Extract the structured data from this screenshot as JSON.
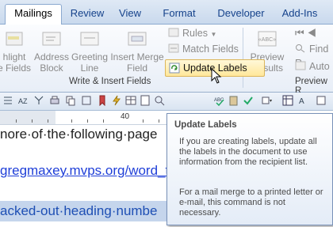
{
  "tabs": [
    {
      "label": "Mailings",
      "active": true
    },
    {
      "label": "Review"
    },
    {
      "label": "View"
    },
    {
      "label": "Format"
    },
    {
      "label": "Developer"
    },
    {
      "label": "Add-Ins"
    }
  ],
  "ribbon": {
    "highlight_merge_fields": {
      "line1": "hlight",
      "line2": "e Fields"
    },
    "address_block": {
      "line1": "Address",
      "line2": "Block"
    },
    "greeting_line": {
      "line1": "Greeting",
      "line2": "Line"
    },
    "insert_merge_field": {
      "line1": "Insert Merge",
      "line2": "Field"
    },
    "rules": "Rules",
    "match_fields": "Match Fields",
    "update_labels": "Update Labels",
    "group_write_insert": "Write & Insert Fields",
    "preview_results": {
      "line1": "Preview",
      "line2": "Results"
    },
    "find_re": "Find R",
    "auto": "Auto",
    "group_preview": "Preview R",
    "preview_icon_text": "«ABC»"
  },
  "ruler": {
    "label_40": "40"
  },
  "document": {
    "line_following": "nore·of·the·following·page",
    "line_link": "gregmaxey.mvps.org/word_t",
    "line_heading": "acked-out·heading·numbe"
  },
  "tooltip": {
    "title": "Update Labels",
    "body1": "If you are creating labels, update all the labels in the document to use information from the recipient list.",
    "body2": "For a mail merge to a printed letter or e-mail, this command is not necessary."
  },
  "colors": {
    "accent": "#15428b",
    "highlight": "#ffe79a",
    "link": "#1f3fd8"
  }
}
